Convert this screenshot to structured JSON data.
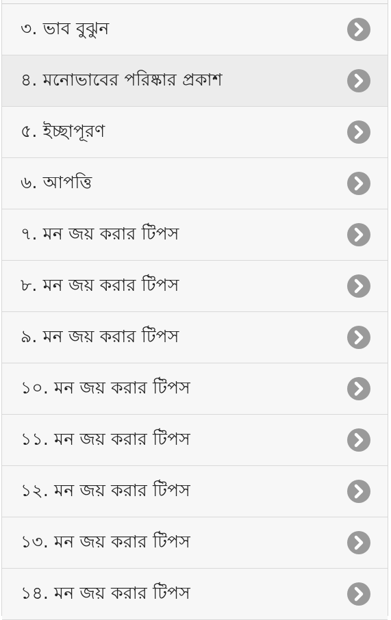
{
  "colors": {
    "row_background": "#f7f7f7",
    "row_highlight": "#ececec",
    "divider": "#d9d9d9",
    "text": "#222222",
    "chevron_circle": "#9a9a9a",
    "chevron_arrow": "#ffffff"
  },
  "list": {
    "items": [
      {
        "label": "৩. ভাব বুঝুন",
        "icon": "chevron-right-circle-icon"
      },
      {
        "label": "৪. মনোভাবের পরিষ্কার প্রকাশ",
        "icon": "chevron-right-circle-icon"
      },
      {
        "label": "৫. ইচ্ছাপূরণ",
        "icon": "chevron-right-circle-icon"
      },
      {
        "label": "৬. আপত্তি",
        "icon": "chevron-right-circle-icon"
      },
      {
        "label": "৭. মন জয় করার টিপস",
        "icon": "chevron-right-circle-icon"
      },
      {
        "label": "৮. মন জয় করার টিপস",
        "icon": "chevron-right-circle-icon"
      },
      {
        "label": "৯. মন জয় করার টিপস",
        "icon": "chevron-right-circle-icon"
      },
      {
        "label": "১০. মন জয় করার টিপস",
        "icon": "chevron-right-circle-icon"
      },
      {
        "label": "১১. মন জয় করার টিপস",
        "icon": "chevron-right-circle-icon"
      },
      {
        "label": "১২. মন জয় করার টিপস",
        "icon": "chevron-right-circle-icon"
      },
      {
        "label": "১৩. মন জয় করার টিপস",
        "icon": "chevron-right-circle-icon"
      },
      {
        "label": "১৪. মন জয় করার টিপস",
        "icon": "chevron-right-circle-icon"
      }
    ]
  }
}
